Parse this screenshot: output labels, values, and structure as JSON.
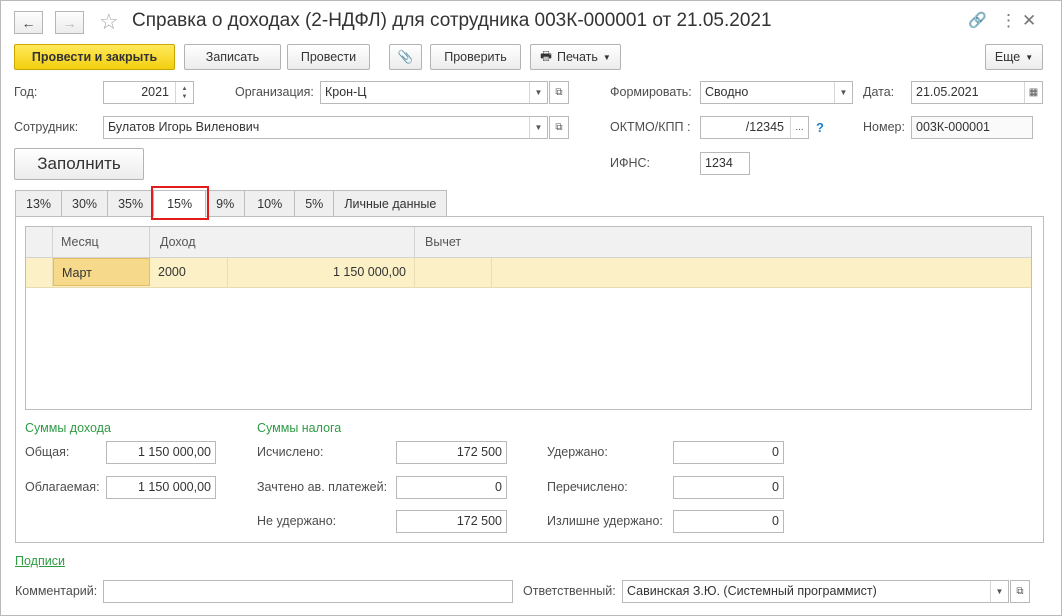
{
  "window": {
    "title": "Справка о доходах (2-НДФЛ) для сотрудника 003К-000001 от 21.05.2021"
  },
  "toolbar": {
    "post_close": "Провести и закрыть",
    "save": "Записать",
    "post": "Провести",
    "check": "Проверить",
    "print": "Печать",
    "more": "Еще"
  },
  "header": {
    "year_label": "Год:",
    "year_value": "2021",
    "org_label": "Организация:",
    "org_value": "Крон-Ц",
    "employee_label": "Сотрудник:",
    "employee_value": "Булатов Игорь Виленович",
    "form_label": "Формировать:",
    "form_value": "Сводно",
    "date_label": "Дата:",
    "date_value": "21.05.2021",
    "oktmo_label": "ОКТМО/КПП :",
    "oktmo_value": "/12345",
    "oktmo_help": "?",
    "number_label": "Номер:",
    "number_value": "003К-000001",
    "ifns_label": "ИФНС:",
    "ifns_value": "1234",
    "fill_button": "Заполнить"
  },
  "tabs": [
    "13%",
    "30%",
    "35%",
    "15%",
    "9%",
    "10%",
    "5%",
    "Личные данные"
  ],
  "active_tab": "15%",
  "table": {
    "columns": [
      "Месяц",
      "Доход",
      "Вычет"
    ],
    "rows": [
      {
        "month": "Март",
        "code": "2000",
        "amount": "1 150 000,00",
        "deduction": ""
      }
    ]
  },
  "income": {
    "title": "Суммы дохода",
    "total_label": "Общая:",
    "total_value": "1 150 000,00",
    "taxable_label": "Облагаемая:",
    "taxable_value": "1 150 000,00"
  },
  "tax": {
    "title": "Суммы налога",
    "calculated_label": "Исчислено:",
    "calculated_value": "172 500",
    "advance_label": "Зачтено ав. платежей:",
    "advance_value": "0",
    "not_withheld_label": "Не удержано:",
    "not_withheld_value": "172 500",
    "withheld_label": "Удержано:",
    "withheld_value": "0",
    "transferred_label": "Перечислено:",
    "transferred_value": "0",
    "excess_label": "Излишне удержано:",
    "excess_value": "0"
  },
  "footer": {
    "signatures_link": "Подписи",
    "comment_label": "Комментарий:",
    "comment_value": "",
    "responsible_label": "Ответственный:",
    "responsible_value": "Савинская З.Ю. (Системный программист)"
  },
  "colors": {
    "primary_button": "#f3cf10",
    "selected_row": "#fbf0c6",
    "section_green": "#2f9b45",
    "tab_highlight": "#e21b1b"
  }
}
